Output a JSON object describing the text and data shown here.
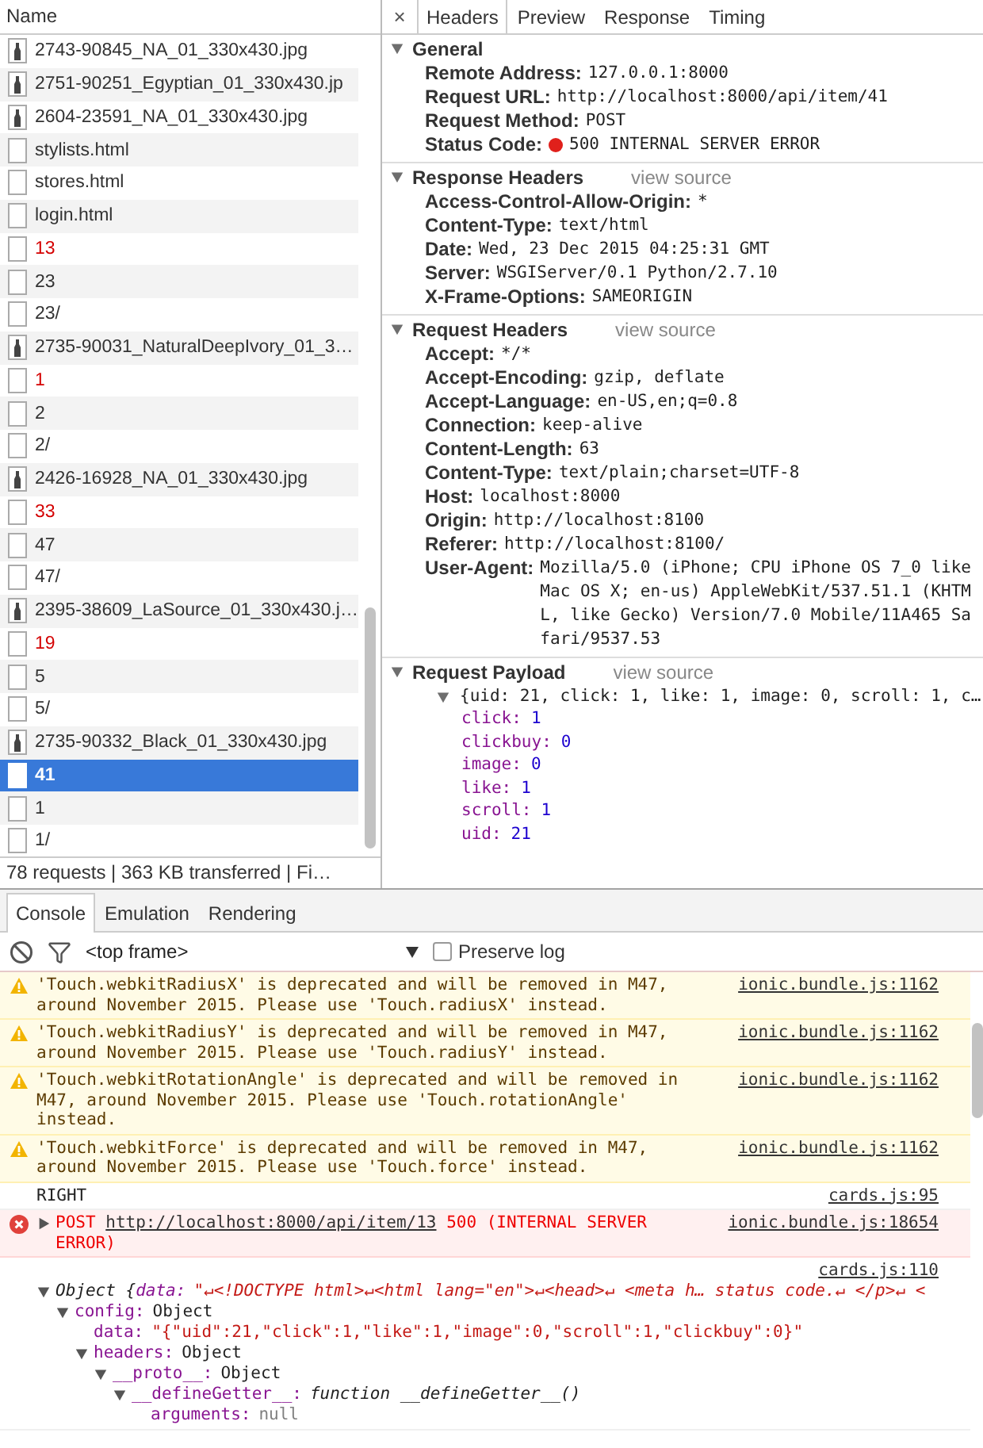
{
  "network": {
    "column_header": "Name",
    "requests": [
      {
        "name": "2743-90845_NA_01_330x430.jpg",
        "kind": "image",
        "error": false,
        "selected": false
      },
      {
        "name": "2751-90251_Egyptian_01_330x430.jp",
        "kind": "image",
        "error": false,
        "selected": false
      },
      {
        "name": "2604-23591_NA_01_330x430.jpg",
        "kind": "image",
        "error": false,
        "selected": false
      },
      {
        "name": "stylists.html",
        "kind": "document",
        "error": false,
        "selected": false
      },
      {
        "name": "stores.html",
        "kind": "document",
        "error": false,
        "selected": false
      },
      {
        "name": "login.html",
        "kind": "document",
        "error": false,
        "selected": false
      },
      {
        "name": "13",
        "kind": "document",
        "error": true,
        "selected": false
      },
      {
        "name": "23",
        "kind": "document",
        "error": false,
        "selected": false
      },
      {
        "name": "23/",
        "kind": "document",
        "error": false,
        "selected": false
      },
      {
        "name": "2735-90031_NaturalDeepIvory_01_3…",
        "kind": "image",
        "error": false,
        "selected": false
      },
      {
        "name": "1",
        "kind": "document",
        "error": true,
        "selected": false
      },
      {
        "name": "2",
        "kind": "document",
        "error": false,
        "selected": false
      },
      {
        "name": "2/",
        "kind": "document",
        "error": false,
        "selected": false
      },
      {
        "name": "2426-16928_NA_01_330x430.jpg",
        "kind": "image",
        "error": false,
        "selected": false
      },
      {
        "name": "33",
        "kind": "document",
        "error": true,
        "selected": false
      },
      {
        "name": "47",
        "kind": "document",
        "error": false,
        "selected": false
      },
      {
        "name": "47/",
        "kind": "document",
        "error": false,
        "selected": false
      },
      {
        "name": "2395-38609_LaSource_01_330x430.j…",
        "kind": "image",
        "error": false,
        "selected": false
      },
      {
        "name": "19",
        "kind": "document",
        "error": true,
        "selected": false
      },
      {
        "name": "5",
        "kind": "document",
        "error": false,
        "selected": false
      },
      {
        "name": "5/",
        "kind": "document",
        "error": false,
        "selected": false
      },
      {
        "name": "2735-90332_Black_01_330x430.jpg",
        "kind": "image",
        "error": false,
        "selected": false
      },
      {
        "name": "41",
        "kind": "document",
        "error": false,
        "selected": true
      },
      {
        "name": "1",
        "kind": "document",
        "error": false,
        "selected": false
      },
      {
        "name": "1/",
        "kind": "document",
        "error": false,
        "selected": false
      }
    ],
    "summary": "78 requests | 363 KB transferred | Fi…"
  },
  "details": {
    "close": "×",
    "tabs": [
      {
        "label": "Headers",
        "selected": true
      },
      {
        "label": "Preview",
        "selected": false
      },
      {
        "label": "Response",
        "selected": false
      },
      {
        "label": "Timing",
        "selected": false
      }
    ],
    "sections": [
      {
        "kind": "headers",
        "title": "General",
        "expanded": true,
        "rows": [
          {
            "key": "Remote Address:",
            "value": "127.0.0.1:8000"
          },
          {
            "key": "Request URL:",
            "value": "http://localhost:8000/api/item/41"
          },
          {
            "key": "Request Method:",
            "value": "POST"
          },
          {
            "key": "Status Code:",
            "value": "500 INTERNAL SERVER ERROR",
            "color": "#e0201b"
          }
        ]
      },
      {
        "kind": "headers",
        "title": "Response Headers",
        "expanded": true,
        "view_source": "view source",
        "rows": [
          {
            "key": "Access-Control-Allow-Origin:",
            "value": "*"
          },
          {
            "key": "Content-Type:",
            "value": "text/html"
          },
          {
            "key": "Date:",
            "value": "Wed, 23 Dec 2015 04:25:31 GMT"
          },
          {
            "key": "Server:",
            "value": "WSGIServer/0.1 Python/2.7.10"
          },
          {
            "key": "X-Frame-Options:",
            "value": "SAMEORIGIN"
          }
        ]
      },
      {
        "kind": "headers",
        "title": "Request Headers",
        "expanded": true,
        "view_source": "view source",
        "rows": [
          {
            "key": "Accept:",
            "value": "*/*"
          },
          {
            "key": "Accept-Encoding:",
            "value": "gzip, deflate"
          },
          {
            "key": "Accept-Language:",
            "value": "en-US,en;q=0.8"
          },
          {
            "key": "Connection:",
            "value": "keep-alive"
          },
          {
            "key": "Content-Length:",
            "value": "63"
          },
          {
            "key": "Content-Type:",
            "value": "text/plain;charset=UTF-8"
          },
          {
            "key": "Host:",
            "value": "localhost:8000"
          },
          {
            "key": "Origin:",
            "value": "http://localhost:8100"
          },
          {
            "key": "Referer:",
            "value": "http://localhost:8100/"
          },
          {
            "key": "User-Agent:",
            "value": "Mozilla/5.0 (iPhone; CPU iPhone OS 7_0 like Mac OS X; en-us) AppleWebKit/537.51.1 (KHTML, like Gecko) Version/7.0 Mobile/11A465 Safari/9537.53"
          }
        ]
      },
      {
        "kind": "payload",
        "title": "Request Payload",
        "expanded": true,
        "view_source": "view source",
        "summary": "{uid: 21, click: 1, like: 1, image: 0, scroll: 1, c…",
        "summary_expanded": true,
        "props": [
          {
            "key": "click:",
            "value": "1"
          },
          {
            "key": "clickbuy:",
            "value": "0"
          },
          {
            "key": "image:",
            "value": "0"
          },
          {
            "key": "like:",
            "value": "1"
          },
          {
            "key": "scroll:",
            "value": "1"
          },
          {
            "key": "uid:",
            "value": "21"
          }
        ]
      }
    ]
  },
  "console": {
    "tabs": [
      {
        "label": "Console",
        "selected": true
      },
      {
        "label": "Emulation",
        "selected": false
      },
      {
        "label": "Rendering",
        "selected": false
      }
    ],
    "frame": "<top frame>",
    "preserve_log": {
      "label": "Preserve log",
      "checked": false
    },
    "messages": [
      {
        "kind": "warning",
        "text": "'Touch.webkitRadiusX' is deprecated and will be removed in M47, around November 2015. Please use 'Touch.radiusX' instead.",
        "source": "ionic.bundle.js:1162"
      },
      {
        "kind": "warning",
        "text": "'Touch.webkitRadiusY' is deprecated and will be removed in M47, around November 2015. Please use 'Touch.radiusY' instead.",
        "source": "ionic.bundle.js:1162"
      },
      {
        "kind": "warning",
        "text": "'Touch.webkitRotationAngle' is deprecated and will be removed in M47, around November 2015. Please use 'Touch.rotationAngle' instead.",
        "source": "ionic.bundle.js:1162"
      },
      {
        "kind": "warning",
        "text": "'Touch.webkitForce' is deprecated and will be removed in M47, around November 2015. Please use 'Touch.force' instead.",
        "source": "ionic.bundle.js:1162"
      },
      {
        "kind": "log",
        "text": "RIGHT",
        "source": "cards.js:95"
      },
      {
        "kind": "error",
        "expanded": false,
        "method": "POST",
        "url": "http://localhost:8000/api/item/13",
        "status": "500 (INTERNAL SERVER ERROR)",
        "source": "ionic.bundle.js:18654"
      },
      {
        "kind": "object",
        "source": "cards.js:110",
        "root": {
          "prefix": "Object {",
          "key": "data:",
          "value": "\"↵<!DOCTYPE html>↵<html lang=\"en\">↵<head>↵ <meta h… status code.↵ </p>↵ <",
          "kind": "string",
          "expanded": true,
          "children": [
            {
              "key": "config:",
              "value": "Object",
              "kind": "object",
              "expanded": true,
              "children": [
                {
                  "key": "data:",
                  "value": "\"{\"uid\":21,\"click\":1,\"like\":1,\"image\":0,\"scroll\":1,\"clickbuy\":0}\"",
                  "kind": "string"
                },
                {
                  "key": "headers:",
                  "value": "Object",
                  "kind": "object",
                  "expanded": true,
                  "children": [
                    {
                      "key": "__proto__:",
                      "value": "Object",
                      "kind": "object",
                      "expanded": true,
                      "children": [
                        {
                          "key": "__defineGetter__:",
                          "value": "function __defineGetter__()",
                          "kind": "function",
                          "expanded": true,
                          "children": [
                            {
                              "key": "arguments:",
                              "value": "null",
                              "kind": "null"
                            }
                          ]
                        }
                      ]
                    }
                  ]
                }
              ]
            }
          ]
        }
      }
    ]
  }
}
